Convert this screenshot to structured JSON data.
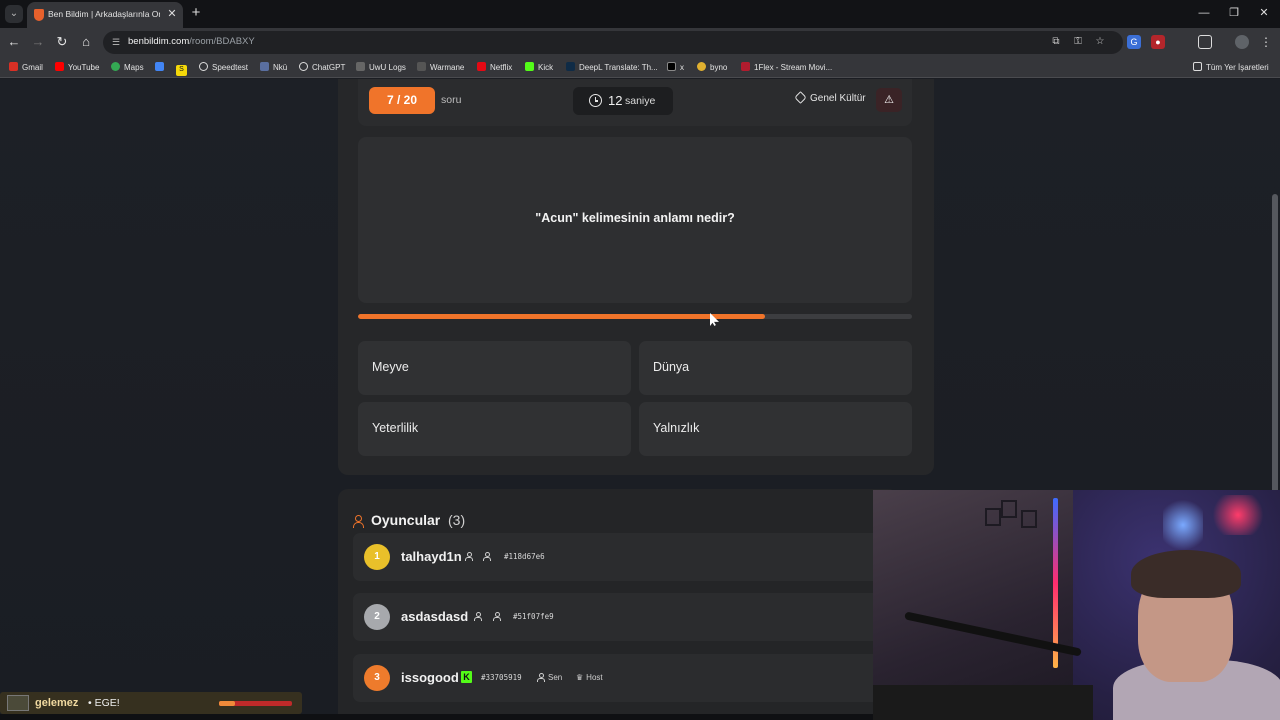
{
  "browser": {
    "tab_title": "Ben Bildim | Arkadaşlarınla Onl",
    "url_host": "benbildim.com",
    "url_path": "/room/BDABXY",
    "bookmarks": [
      "Gmail",
      "YouTube",
      "Maps",
      "S",
      "Speedtest",
      "Nkü",
      "ChatGPT",
      "UwU Logs",
      "Warmane",
      "Netflix",
      "Kick",
      "DeepL Translate: Th...",
      "x",
      "byno",
      "1Flex - Stream Movi..."
    ],
    "all_bookmarks": "Tüm Yer İşaretleri"
  },
  "game": {
    "progress": "7 / 20",
    "progress_label": "soru",
    "timer_value": "12",
    "timer_unit": "saniye",
    "category": "Genel Kültür",
    "report_icon": "⚠",
    "question": "\"Acun\" kelimesinin anlamı nedir?",
    "time_remaining_fraction": 0.735,
    "answers": [
      "Meyve",
      "Dünya",
      "Yeterlilik",
      "Yalnızlık"
    ]
  },
  "players": {
    "title": "Oyuncular",
    "count": "(3)",
    "list": [
      {
        "rank": "1",
        "name": "talhayd1n",
        "id": "#118d67e6",
        "color": "#e9c02a"
      },
      {
        "rank": "2",
        "name": "asdasdasd",
        "id": "#51f07fe9",
        "color": "#a7a9ad"
      },
      {
        "rank": "3",
        "name": "issogood",
        "id": "#33705919",
        "color": "#ee7b2c",
        "sen": "Sen",
        "host": "Host"
      }
    ]
  },
  "chat": {
    "user": "gelemez",
    "message": "• EGE!",
    "bar_fraction": 0.22
  },
  "colors": {
    "accent": "#f0742a",
    "kick_green": "#53fc18"
  }
}
